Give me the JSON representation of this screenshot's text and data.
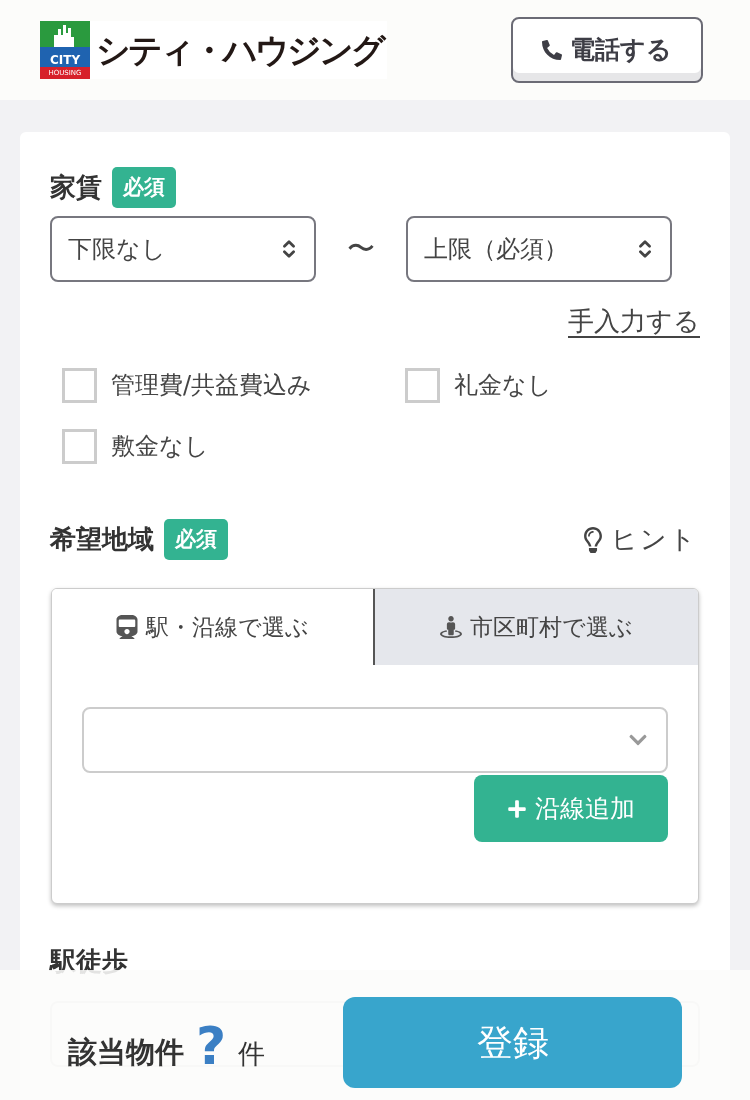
{
  "header": {
    "logo": {
      "mark_top": "CITY",
      "mark_bottom": "HOUSING",
      "name": "シティ・ハウジング"
    },
    "call_button": "電話する"
  },
  "rent": {
    "title": "家賃",
    "badge": "必須",
    "min_select": "下限なし",
    "separator": "〜",
    "max_select": "上限（必須）",
    "manual_link": "手入力する",
    "options": [
      {
        "label": "管理費/共益費込み",
        "checked": false
      },
      {
        "label": "礼金なし",
        "checked": false
      },
      {
        "label": "敷金なし",
        "checked": false
      }
    ]
  },
  "area": {
    "title": "希望地域",
    "badge": "必須",
    "hint": "ヒント",
    "tabs": [
      {
        "label": "駅・沿線で選ぶ",
        "selected": true
      },
      {
        "label": "市区町村で選ぶ",
        "selected": false
      }
    ],
    "add_button": "沿線追加"
  },
  "walk": {
    "title": "駅徒歩"
  },
  "footer": {
    "result_label": "該当物件",
    "count": "?",
    "unit": "件",
    "register_button": "登録"
  }
}
